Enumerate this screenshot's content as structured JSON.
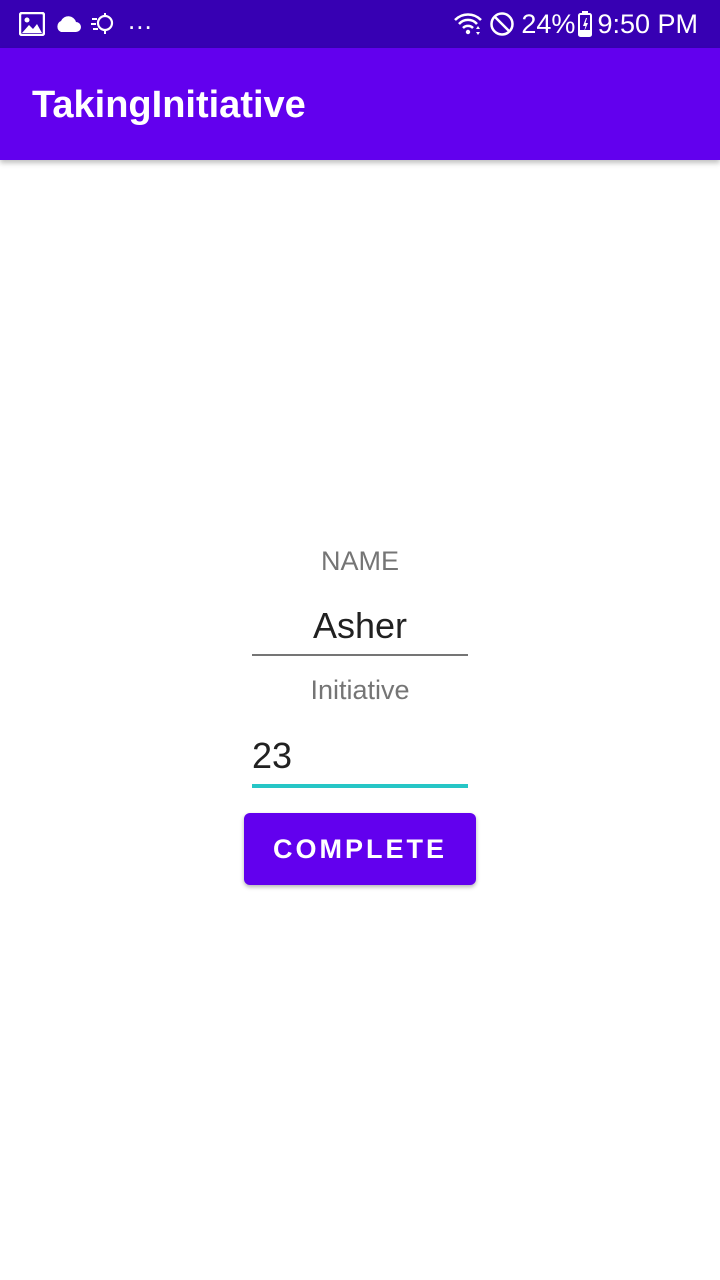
{
  "status_bar": {
    "left_icons": [
      "image-icon",
      "cloud-icon",
      "sync-icon"
    ],
    "ellipsis": "...",
    "right_icons": [
      "wifi-icon",
      "do-not-disturb-icon",
      "battery-icon"
    ],
    "battery": "24%",
    "time": "9:50 PM"
  },
  "app_bar": {
    "title": "TakingInitiative"
  },
  "form": {
    "name_label": "NAME",
    "name_value": "Asher",
    "initiative_label": "Initiative",
    "initiative_value": "23",
    "complete_label": "COMPLETE"
  },
  "colors": {
    "status_bar": "#3700B3",
    "primary": "#6200EE",
    "focus_underline": "#26C6C6"
  }
}
